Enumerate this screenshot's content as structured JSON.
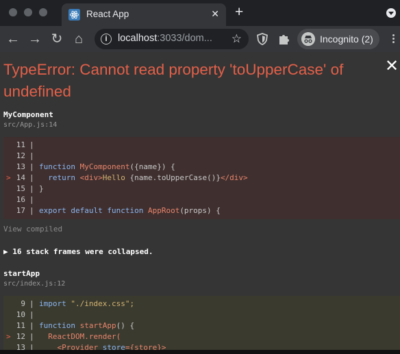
{
  "window": {
    "tab_title": "React App",
    "tab_close_glyph": "✕",
    "new_tab_glyph": "+"
  },
  "toolbar": {
    "back_glyph": "←",
    "forward_glyph": "→",
    "reload_glyph": "↻",
    "home_glyph": "⌂",
    "url_host": "localhost",
    "url_rest": ":3033/dom...",
    "info_glyph": "i",
    "star_glyph": "☆",
    "incognito_label": "Incognito (2)",
    "icons": [
      "arrow-left-icon",
      "arrow-right-icon",
      "reload-icon",
      "home-icon",
      "info-icon",
      "star-icon",
      "shield-icon",
      "puzzle-icon",
      "incognito-icon",
      "more-vert-icon"
    ]
  },
  "error": {
    "title": "TypeError: Cannot read property 'toUpperCase' of undefined",
    "close_glyph": "✕",
    "view_compiled": "View compiled",
    "collapsed_text": "▶ 16 stack frames were collapsed."
  },
  "frames": [
    {
      "function": "MyComponent",
      "location": "src/App.js:14",
      "lines": [
        {
          "marker": "",
          "num": "11",
          "parts": []
        },
        {
          "marker": "",
          "num": "12",
          "parts": []
        },
        {
          "marker": "",
          "num": "13",
          "parts": [
            {
              "t": "function ",
              "c": "kw"
            },
            {
              "t": "MyComponent",
              "c": "fn"
            },
            {
              "t": "({name}) {",
              "c": "plain"
            }
          ]
        },
        {
          "marker": ">",
          "num": "14",
          "parts": [
            {
              "t": "  return ",
              "c": "kw"
            },
            {
              "t": "<div>",
              "c": "tag"
            },
            {
              "t": "Hello ",
              "c": "str"
            },
            {
              "t": "{name.toUpperCase()}",
              "c": "plain"
            },
            {
              "t": "</div>",
              "c": "tag"
            }
          ]
        },
        {
          "marker": "",
          "num": "15",
          "parts": [
            {
              "t": "}",
              "c": "plain"
            }
          ]
        },
        {
          "marker": "",
          "num": "16",
          "parts": []
        },
        {
          "marker": "",
          "num": "17",
          "parts": [
            {
              "t": "export default function ",
              "c": "kw"
            },
            {
              "t": "AppRoot",
              "c": "fn"
            },
            {
              "t": "(props) {",
              "c": "plain"
            }
          ]
        }
      ]
    },
    {
      "function": "startApp",
      "location": "src/index.js:12",
      "lines": [
        {
          "marker": "",
          "num": "9",
          "parts": [
            {
              "t": "import ",
              "c": "kw"
            },
            {
              "t": "\"./index.css\";",
              "c": "str"
            }
          ]
        },
        {
          "marker": "",
          "num": "10",
          "parts": []
        },
        {
          "marker": "",
          "num": "11",
          "parts": [
            {
              "t": "function ",
              "c": "kw"
            },
            {
              "t": "startApp",
              "c": "fn"
            },
            {
              "t": "() {",
              "c": "plain"
            }
          ]
        },
        {
          "marker": ">",
          "num": "12",
          "parts": [
            {
              "t": "  ReactDOM.render(",
              "c": "fn"
            }
          ]
        },
        {
          "marker": "",
          "num": "13",
          "parts": [
            {
              "t": "    <Provider ",
              "c": "tag"
            },
            {
              "t": "store",
              "c": "kw"
            },
            {
              "t": "={store}>",
              "c": "tag"
            }
          ]
        }
      ]
    }
  ],
  "colors": {
    "error_red": "#e36049",
    "overlay_bg": "#353535",
    "code_red_bg": "#3f2f2f",
    "code_yellow_bg": "#3a3a2f"
  }
}
